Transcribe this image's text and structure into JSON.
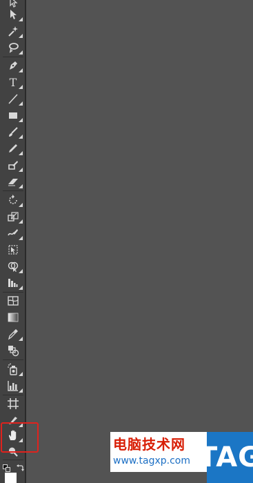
{
  "toolbar": {
    "tools": [
      {
        "name": "selection-arrow-tool",
        "icon": "cursor-outline-icon"
      },
      {
        "name": "direct-selection-tool",
        "icon": "arrow-icon"
      },
      {
        "name": "magic-wand-tool",
        "icon": "magic-wand-icon"
      },
      {
        "name": "lasso-tool",
        "icon": "lasso-icon"
      },
      {
        "name": "pen-tool",
        "icon": "pen-nib-icon"
      },
      {
        "name": "type-tool",
        "icon": "type-icon",
        "glyph": "T"
      },
      {
        "name": "line-segment-tool",
        "icon": "line-icon"
      },
      {
        "name": "rectangle-tool",
        "icon": "rectangle-icon"
      },
      {
        "name": "paintbrush-tool",
        "icon": "brush-icon"
      },
      {
        "name": "pencil-tool",
        "icon": "pencil-icon"
      },
      {
        "name": "blob-brush-tool",
        "icon": "blob-brush-icon"
      },
      {
        "name": "eraser-tool",
        "icon": "eraser-icon"
      },
      {
        "name": "rotate-tool",
        "icon": "rotate-icon"
      },
      {
        "name": "scale-tool",
        "icon": "scale-icon"
      },
      {
        "name": "warp-tool",
        "icon": "warp-icon"
      },
      {
        "name": "free-transform-tool",
        "icon": "free-transform-icon"
      },
      {
        "name": "shape-builder-tool",
        "icon": "shape-builder-icon"
      },
      {
        "name": "perspective-grid-tool",
        "icon": "perspective-grid-icon"
      },
      {
        "name": "mesh-tool",
        "icon": "mesh-icon"
      },
      {
        "name": "gradient-tool",
        "icon": "gradient-icon"
      },
      {
        "name": "eyedropper-tool",
        "icon": "eyedropper-icon"
      },
      {
        "name": "blend-tool",
        "icon": "blend-icon"
      },
      {
        "name": "symbol-sprayer-tool",
        "icon": "symbol-sprayer-icon"
      },
      {
        "name": "column-graph-tool",
        "icon": "column-graph-icon"
      },
      {
        "name": "artboard-tool",
        "icon": "artboard-icon"
      },
      {
        "name": "slice-tool",
        "icon": "slice-icon"
      },
      {
        "name": "hand-tool",
        "icon": "hand-icon"
      },
      {
        "name": "zoom-tool",
        "icon": "magnifier-icon"
      }
    ],
    "swap_colors_icon": "swap-arrow-icon",
    "default_colors_icon": "default-colors-icon"
  },
  "colors": {
    "panel": "#424242",
    "canvas": "#535353",
    "highlight": "#e0221d",
    "icon": "#d8d8d8"
  },
  "watermark": {
    "title": "电脑技术网",
    "url": "www.tagxp.com",
    "logo": "TAG"
  }
}
